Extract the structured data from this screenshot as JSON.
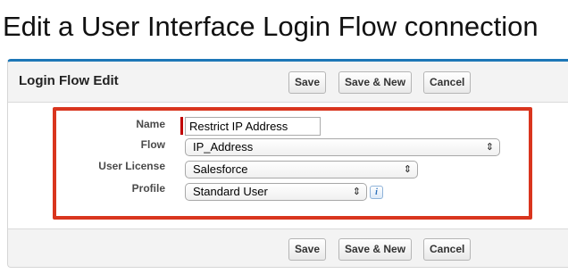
{
  "page": {
    "title": "Edit a User Interface Login Flow connection"
  },
  "panel": {
    "title": "Login Flow Edit",
    "buttons": {
      "save": "Save",
      "save_new": "Save & New",
      "cancel": "Cancel"
    }
  },
  "form": {
    "name": {
      "label": "Name",
      "value": "Restrict IP Address"
    },
    "flow": {
      "label": "Flow",
      "selected": "IP_Address"
    },
    "user_license": {
      "label": "User License",
      "selected": "Salesforce"
    },
    "profile": {
      "label": "Profile",
      "selected": "Standard User",
      "info_icon": "i"
    }
  },
  "icons": {
    "select_arrows": "⇕",
    "info": "info-icon"
  },
  "colors": {
    "highlight": "#d9351e",
    "required": "#c00000",
    "panel_accent": "#1d77b7"
  }
}
